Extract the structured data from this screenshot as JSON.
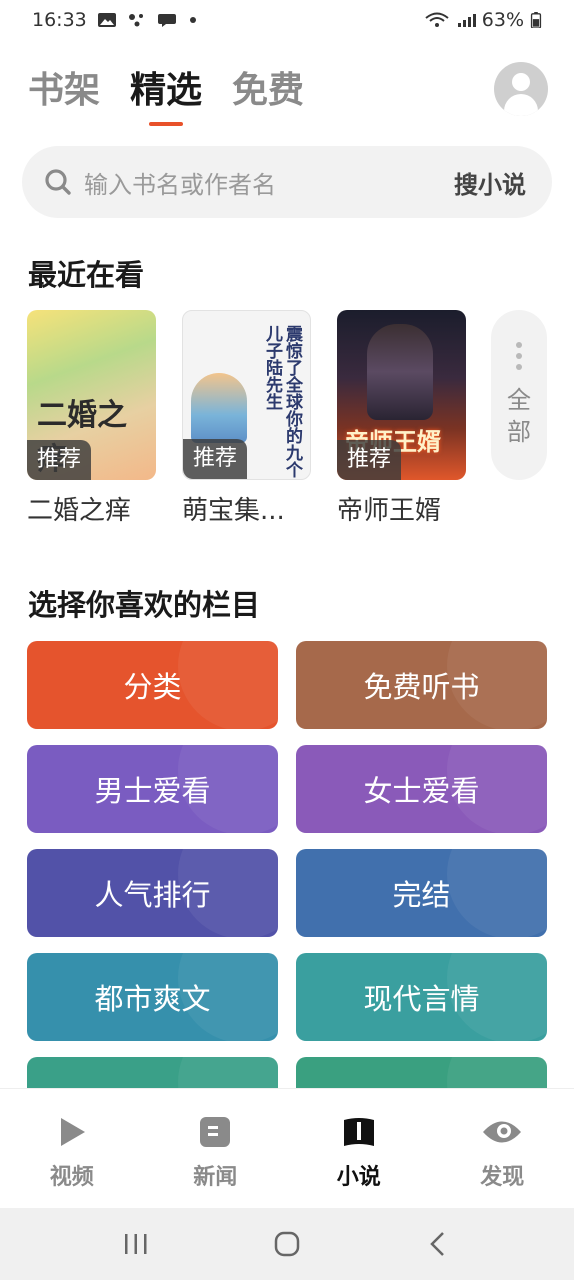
{
  "status_bar": {
    "time": "16:33",
    "battery": "63%"
  },
  "top_tabs": [
    {
      "label": "书架",
      "active": false
    },
    {
      "label": "精选",
      "active": true
    },
    {
      "label": "免费",
      "active": false
    }
  ],
  "accent_color": "#e8512a",
  "search": {
    "placeholder": "输入书名或作者名",
    "button": "搜小说"
  },
  "recent": {
    "title": "最近在看",
    "books": [
      {
        "name": "二婚之痒",
        "badge": "推荐",
        "cover_text": "二婚之痒"
      },
      {
        "name": "萌宝集...",
        "badge": "推荐",
        "cover_text": "震惊了全球你的九个儿子陆先生"
      },
      {
        "name": "帝师王婿",
        "badge": "推荐",
        "cover_text": "帝师王婿"
      }
    ],
    "more_label": "全部"
  },
  "categories": {
    "title": "选择你喜欢的栏目",
    "items": [
      {
        "label": "分类",
        "color": "#e5542d"
      },
      {
        "label": "免费听书",
        "color": "#a6694b"
      },
      {
        "label": "男士爱看",
        "color": "#7a5cc1"
      },
      {
        "label": "女士爱看",
        "color": "#8a5ab9"
      },
      {
        "label": "人气排行",
        "color": "#5252a8"
      },
      {
        "label": "完结",
        "color": "#4170ad"
      },
      {
        "label": "都市爽文",
        "color": "#3690ac"
      },
      {
        "label": "现代言情",
        "color": "#3a9f9f"
      },
      {
        "label": "",
        "color": "#3aa088"
      },
      {
        "label": "",
        "color": "#3aa080"
      }
    ]
  },
  "bottom_nav": [
    {
      "label": "视频",
      "icon": "play-icon",
      "active": false
    },
    {
      "label": "新闻",
      "icon": "news-icon",
      "active": false
    },
    {
      "label": "小说",
      "icon": "book-icon",
      "active": true
    },
    {
      "label": "发现",
      "icon": "eye-icon",
      "active": false
    }
  ]
}
